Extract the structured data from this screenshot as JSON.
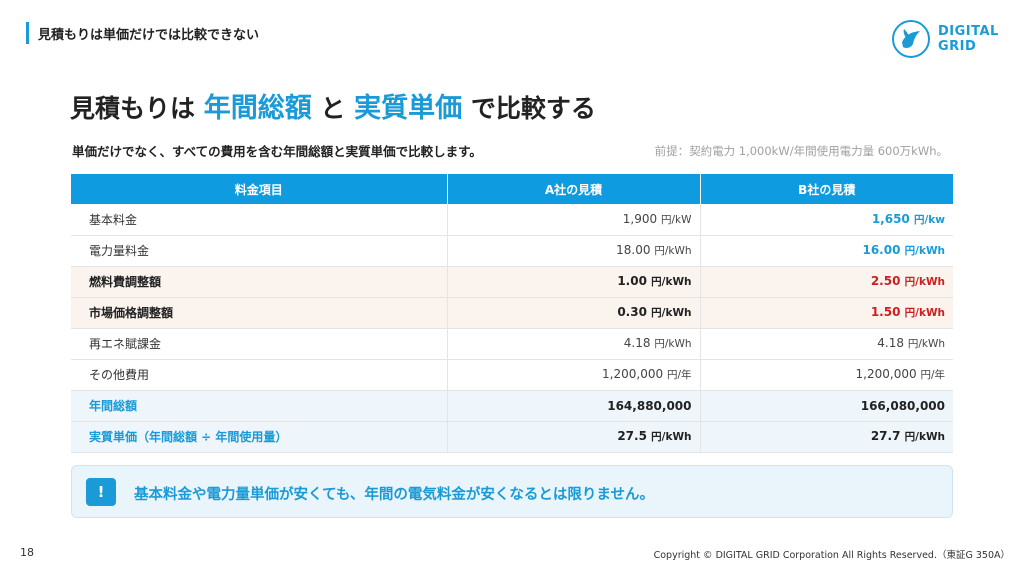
{
  "section_title": "見積もりは単価だけでは比較できない",
  "logo": {
    "line1": "DIGITAL",
    "line2": "GRID",
    "color": "#1a9ad6"
  },
  "headline": {
    "part1": "見積もりは ",
    "highlight1": "年間総額",
    "part2": " と ",
    "highlight2": "実質単価",
    "part3": " で比較する"
  },
  "subline": "単価だけでなく、すべての費用を含む年間総額と実質単価で比較します。",
  "premise": "前提：契約電力 1,000kW/年間使用電力量 600万kWh。",
  "table": {
    "headers": [
      "料金項目",
      "A社の見積",
      "B社の見積"
    ],
    "rows": [
      {
        "label": "基本料金",
        "a": "1,900",
        "a_unit": "円/kW",
        "b": "1,650",
        "b_unit": "円/kw"
      },
      {
        "label": "電力量料金",
        "a": "18.00",
        "a_unit": "円/kWh",
        "b": "16.00",
        "b_unit": "円/kWh"
      },
      {
        "label": "燃料費調整額",
        "a": "1.00",
        "a_unit": "円/kWh",
        "b": "2.50",
        "b_unit": "円/kWh"
      },
      {
        "label": "市場価格調整額",
        "a": "0.30",
        "a_unit": "円/kWh",
        "b": "1.50",
        "b_unit": "円/kWh"
      },
      {
        "label": "再エネ賦課金",
        "a": "4.18",
        "a_unit": "円/kWh",
        "b": "4.18",
        "b_unit": "円/kWh"
      },
      {
        "label": "その他費用",
        "a": "1,200,000",
        "a_unit": "円/年",
        "b": "1,200,000",
        "b_unit": "円/年"
      },
      {
        "label": "年間総額",
        "a": "164,880,000",
        "a_unit": "",
        "b": "166,080,000",
        "b_unit": ""
      },
      {
        "label": "実質単価（年間総額 ÷ 年間使用量）",
        "a": "27.5",
        "a_unit": "円/kWh",
        "b": "27.7",
        "b_unit": "円/kWh"
      }
    ]
  },
  "notice": {
    "icon": "!",
    "text": "基本料金や電力量単価が安くても、年間の電気料金が安くなるとは限りません。"
  },
  "page_number": "18",
  "copyright": "Copyright © DIGITAL GRID Corporation All Rights Reserved.（東証G 350A）",
  "colors": {
    "accent": "#1a9ad6",
    "header_bg": "#0f9be0",
    "red": "#cc1f1f"
  }
}
